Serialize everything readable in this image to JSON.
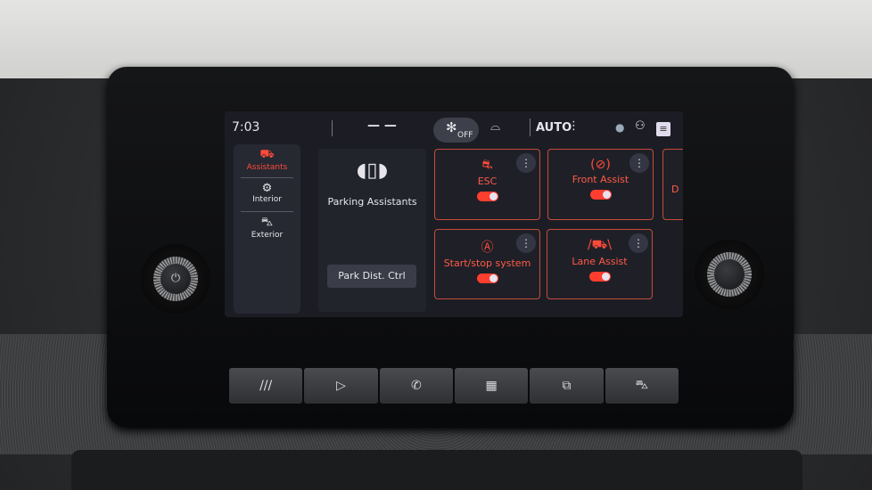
{
  "status_bar": {
    "time": "7:03",
    "temperature": "— —",
    "fan_label": "OFF",
    "climate_mode": "AUTO"
  },
  "sidebar": {
    "items": [
      {
        "label": "Assistants",
        "icon": "car-assist-icon",
        "active": true
      },
      {
        "label": "Interior",
        "icon": "interior-icon"
      },
      {
        "label": "Exterior",
        "icon": "exterior-icon"
      }
    ]
  },
  "parking": {
    "title": "Parking Assistants",
    "button": "Park Dist. Ctrl"
  },
  "tiles": [
    {
      "label": "ESC",
      "icon": "esc-icon",
      "on": true
    },
    {
      "label": "Front Assist",
      "icon": "front-assist-icon",
      "on": true
    },
    {
      "label": "Start/stop system",
      "icon": "start-stop-icon",
      "on": true
    },
    {
      "label": "Lane Assist",
      "icon": "lane-assist-icon",
      "on": true
    }
  ],
  "partial_tile_letter": "D",
  "hardware_buttons": [
    {
      "label": "///",
      "icon": "menu-icon"
    },
    {
      "icon": "play-icon"
    },
    {
      "icon": "phone-icon"
    },
    {
      "icon": "apps-icon"
    },
    {
      "icon": "car-settings-icon"
    },
    {
      "icon": "vehicle-icon"
    }
  ],
  "colors": {
    "accent": "#ff4a3a",
    "screen_bg": "#1c1d24"
  }
}
